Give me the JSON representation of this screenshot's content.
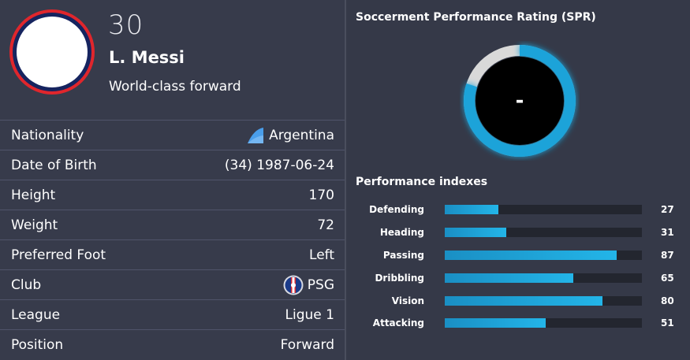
{
  "player": {
    "number": "30",
    "name": "L. Messi",
    "description": "World-class forward"
  },
  "info": [
    {
      "label": "Nationality",
      "value": "Argentina",
      "icon": "argentina-flag-icon"
    },
    {
      "label": "Date of Birth",
      "value": "(34) 1987-06-24"
    },
    {
      "label": "Height",
      "value": "170"
    },
    {
      "label": "Weight",
      "value": "72"
    },
    {
      "label": "Preferred Foot",
      "value": "Left"
    },
    {
      "label": "Club",
      "value": "PSG",
      "icon": "psg-badge-icon"
    },
    {
      "label": "League",
      "value": "Ligue 1"
    },
    {
      "label": "Position",
      "value": "Forward"
    }
  ],
  "spr": {
    "title": "Soccerment Performance Rating (SPR)",
    "value": "-",
    "fill_fraction": 0.8,
    "colors": {
      "fill": "#1aa3d9",
      "track": "#d9d9d9",
      "center": "#000000"
    }
  },
  "performance": {
    "title": "Performance indexes",
    "max": 100,
    "items": [
      {
        "label": "Defending",
        "value": 27
      },
      {
        "label": "Heading",
        "value": 31
      },
      {
        "label": "Passing",
        "value": 87
      },
      {
        "label": "Dribbling",
        "value": 65
      },
      {
        "label": "Vision",
        "value": 80
      },
      {
        "label": "Attacking",
        "value": 51
      }
    ]
  }
}
